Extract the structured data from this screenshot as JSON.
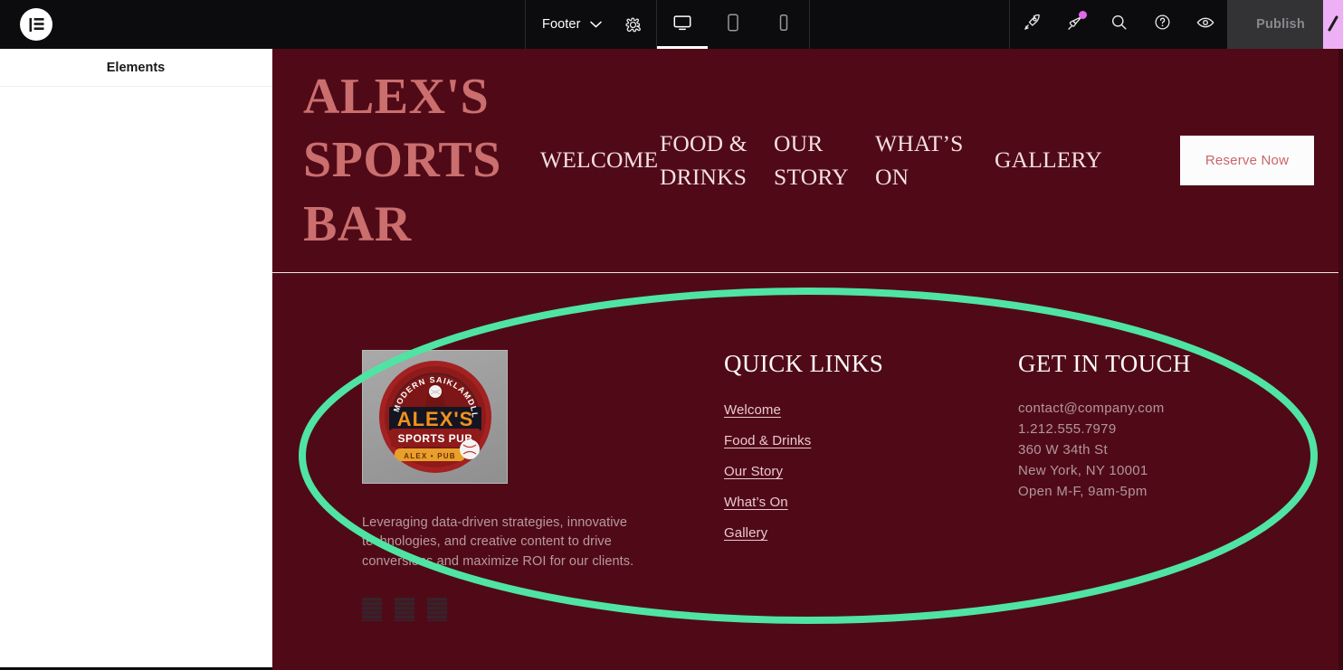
{
  "editor": {
    "logo_icon": "elementor-logo-icon",
    "document_name": "Footer",
    "document_chevron_icon": "chevron-down-icon",
    "settings_icon": "gear-icon",
    "devices": [
      {
        "name": "desktop",
        "icon": "desktop-icon",
        "active": true
      },
      {
        "name": "tablet",
        "icon": "tablet-icon",
        "active": false
      },
      {
        "name": "mobile",
        "icon": "mobile-icon",
        "active": false
      }
    ],
    "actions": [
      {
        "name": "launchpad",
        "icon": "rocket-icon",
        "badge": false
      },
      {
        "name": "notifications",
        "icon": "megaphone-icon",
        "badge": true
      },
      {
        "name": "finder",
        "icon": "search-icon",
        "badge": false
      },
      {
        "name": "help",
        "icon": "question-circle-icon",
        "badge": false
      },
      {
        "name": "preview",
        "icon": "eye-icon",
        "badge": false
      }
    ],
    "publish_label": "Publish",
    "panel": {
      "title": "Elements",
      "collapse_icon": "chevron-left-icon"
    }
  },
  "site": {
    "header": {
      "brand": "ALEX'S SPORTS BAR",
      "nav": [
        {
          "label": "WELCOME"
        },
        {
          "label": "FOOD & DRINKS"
        },
        {
          "label": "OUR STORY"
        },
        {
          "label": "WHAT’S ON"
        },
        {
          "label": "GALLERY"
        }
      ],
      "cta_label": "Reserve Now"
    },
    "footer": {
      "logo_alt": "ALEX'S SPORTS PUB badge logo",
      "logo_badge": {
        "arc_text": "MODERN SAIKLAMDLL",
        "title": "ALEX'S",
        "subtitle": "SPORTS PUB",
        "ribbon_text": "ALEX • PUB"
      },
      "description": "Leveraging data-driven strategies, innovative technologies, and creative content to drive conversions and maximize ROI for our clients.",
      "social_placeholders": [
        "social-icon-placeholder-1",
        "social-icon-placeholder-2",
        "social-icon-placeholder-3"
      ],
      "quick_links": {
        "heading": "QUICK LINKS",
        "items": [
          {
            "label": "Welcome"
          },
          {
            "label": "Food & Drinks"
          },
          {
            "label": "Our Story"
          },
          {
            "label": "What’s On"
          },
          {
            "label": "Gallery"
          }
        ]
      },
      "get_in_touch": {
        "heading": "GET IN TOUCH",
        "lines": [
          "contact@company.com",
          "1.212.555.7979",
          "360 W 34th St",
          "New York, NY 10001",
          "Open M-F, 9am-5pm"
        ]
      }
    }
  },
  "annotation": {
    "shape": "ellipse-highlight",
    "color": "#4fe4a4"
  },
  "colors": {
    "site_background": "#500a17",
    "brand_text": "#cb6e6e",
    "nav_text": "#f4dfe2",
    "cta_background": "#fdfcfc",
    "cta_text": "#c8656a",
    "footer_link": "#e9c9ce",
    "footer_muted": "#b2969c",
    "editor_chrome": "#0c0c0e",
    "publish_disabled": "#333336",
    "notification_dot": "#e168e8",
    "cursor_block": "#edb0f4"
  }
}
